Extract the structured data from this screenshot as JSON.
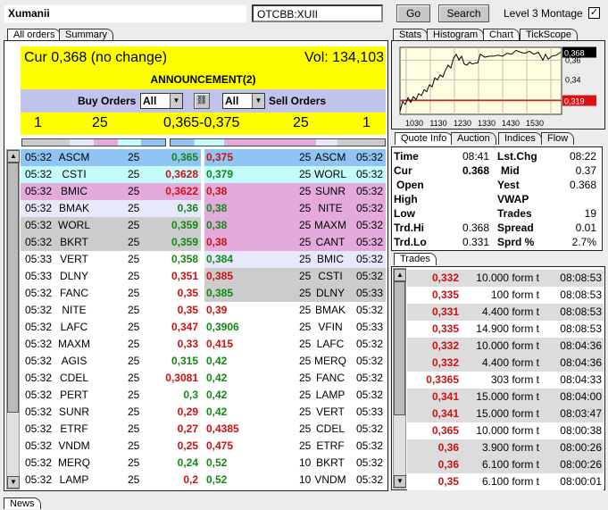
{
  "top": {
    "name": "Xumanii",
    "symbol": "OTCBB:XUII",
    "go": "Go",
    "search": "Search",
    "montage_label": "Level 3 Montage",
    "montage_checked": true
  },
  "left_tabs": [
    "All orders",
    "Summary"
  ],
  "header": {
    "cur": "Cur 0,368 (no change)",
    "vol": "Vol: 134,103",
    "announcement": "ANNOUNCEMENT(2)",
    "buy_label": "Buy Orders",
    "sell_label": "Sell Orders",
    "buy_filter": "All",
    "sell_filter": "All"
  },
  "depth": {
    "buy_count": "1",
    "buy_size": "25",
    "spread": "0,365-0,375",
    "sell_size": "25",
    "sell_count": "1"
  },
  "colors": {
    "blue": "#90c4f4",
    "cyan": "#c4fcfc",
    "pink": "#e4aadc",
    "lav": "#e8e8fc",
    "gray": "#cccccc",
    "white": "#ffffff"
  },
  "buy_orders": [
    {
      "time": "05:32",
      "firm": "ASCM",
      "size": "25",
      "price": "0,365",
      "dir": "g",
      "bg": "blue"
    },
    {
      "time": "05:32",
      "firm": "CSTI",
      "size": "25",
      "price": "0,3628",
      "dir": "r",
      "bg": "cyan"
    },
    {
      "time": "05:32",
      "firm": "BMIC",
      "size": "25",
      "price": "0,3622",
      "dir": "r",
      "bg": "pink"
    },
    {
      "time": "05:32",
      "firm": "BMAK",
      "size": "25",
      "price": "0,36",
      "dir": "g",
      "bg": "lav"
    },
    {
      "time": "05:32",
      "firm": "WORL",
      "size": "25",
      "price": "0,359",
      "dir": "g",
      "bg": "gray"
    },
    {
      "time": "05:32",
      "firm": "BKRT",
      "size": "25",
      "price": "0,359",
      "dir": "g",
      "bg": "gray"
    },
    {
      "time": "05:33",
      "firm": "VERT",
      "size": "25",
      "price": "0,358",
      "dir": "g",
      "bg": "white"
    },
    {
      "time": "05:33",
      "firm": "DLNY",
      "size": "25",
      "price": "0,351",
      "dir": "r",
      "bg": "white"
    },
    {
      "time": "05:32",
      "firm": "FANC",
      "size": "25",
      "price": "0,35",
      "dir": "r",
      "bg": "white"
    },
    {
      "time": "05:32",
      "firm": "NITE",
      "size": "25",
      "price": "0,35",
      "dir": "r",
      "bg": "white"
    },
    {
      "time": "05:32",
      "firm": "LAFC",
      "size": "25",
      "price": "0,347",
      "dir": "r",
      "bg": "white"
    },
    {
      "time": "05:32",
      "firm": "MAXM",
      "size": "25",
      "price": "0,33",
      "dir": "r",
      "bg": "white"
    },
    {
      "time": "05:32",
      "firm": "AGIS",
      "size": "25",
      "price": "0,315",
      "dir": "g",
      "bg": "white"
    },
    {
      "time": "05:32",
      "firm": "CDEL",
      "size": "25",
      "price": "0,3081",
      "dir": "r",
      "bg": "white"
    },
    {
      "time": "05:32",
      "firm": "PERT",
      "size": "25",
      "price": "0,3",
      "dir": "g",
      "bg": "white"
    },
    {
      "time": "05:32",
      "firm": "SUNR",
      "size": "25",
      "price": "0,29",
      "dir": "r",
      "bg": "white"
    },
    {
      "time": "05:32",
      "firm": "ETRF",
      "size": "25",
      "price": "0,27",
      "dir": "r",
      "bg": "white"
    },
    {
      "time": "05:32",
      "firm": "VNDM",
      "size": "25",
      "price": "0,25",
      "dir": "r",
      "bg": "white"
    },
    {
      "time": "05:32",
      "firm": "MERQ",
      "size": "25",
      "price": "0,24",
      "dir": "g",
      "bg": "white"
    },
    {
      "time": "05:32",
      "firm": "LAMP",
      "size": "25",
      "price": "0,2",
      "dir": "r",
      "bg": "white"
    }
  ],
  "sell_orders": [
    {
      "price": "0,375",
      "dir": "r",
      "size": "25",
      "firm": "ASCM",
      "time": "05:32",
      "bg": "blue"
    },
    {
      "price": "0,379",
      "dir": "g",
      "size": "25",
      "firm": "WORL",
      "time": "05:32",
      "bg": "cyan"
    },
    {
      "price": "0,38",
      "dir": "r",
      "size": "25",
      "firm": "SUNR",
      "time": "05:32",
      "bg": "pink"
    },
    {
      "price": "0,38",
      "dir": "g",
      "size": "25",
      "firm": "NITE",
      "time": "05:32",
      "bg": "pink"
    },
    {
      "price": "0,38",
      "dir": "g",
      "size": "25",
      "firm": "MAXM",
      "time": "05:32",
      "bg": "pink"
    },
    {
      "price": "0,38",
      "dir": "r",
      "size": "25",
      "firm": "CANT",
      "time": "05:32",
      "bg": "pink"
    },
    {
      "price": "0,384",
      "dir": "g",
      "size": "25",
      "firm": "BMIC",
      "time": "05:32",
      "bg": "lav"
    },
    {
      "price": "0,385",
      "dir": "r",
      "size": "25",
      "firm": "CSTI",
      "time": "05:32",
      "bg": "gray"
    },
    {
      "price": "0,385",
      "dir": "g",
      "size": "25",
      "firm": "DLNY",
      "time": "05:33",
      "bg": "gray"
    },
    {
      "price": "0,39",
      "dir": "r",
      "size": "25",
      "firm": "BMAK",
      "time": "05:32",
      "bg": "white"
    },
    {
      "price": "0,3906",
      "dir": "g",
      "size": "25",
      "firm": "VFIN",
      "time": "05:33",
      "bg": "white"
    },
    {
      "price": "0,415",
      "dir": "r",
      "size": "25",
      "firm": "LAFC",
      "time": "05:32",
      "bg": "white"
    },
    {
      "price": "0,42",
      "dir": "g",
      "size": "25",
      "firm": "MERQ",
      "time": "05:32",
      "bg": "white"
    },
    {
      "price": "0,42",
      "dir": "g",
      "size": "25",
      "firm": "FANC",
      "time": "05:32",
      "bg": "white"
    },
    {
      "price": "0,42",
      "dir": "g",
      "size": "25",
      "firm": "LAMP",
      "time": "05:32",
      "bg": "white"
    },
    {
      "price": "0,42",
      "dir": "g",
      "size": "25",
      "firm": "VERT",
      "time": "05:33",
      "bg": "white"
    },
    {
      "price": "0,4385",
      "dir": "r",
      "size": "25",
      "firm": "CDEL",
      "time": "05:32",
      "bg": "white"
    },
    {
      "price": "0,475",
      "dir": "r",
      "size": "25",
      "firm": "ETRF",
      "time": "05:32",
      "bg": "white"
    },
    {
      "price": "0,52",
      "dir": "g",
      "size": "10",
      "firm": "BKRT",
      "time": "05:32",
      "bg": "white"
    },
    {
      "price": "0,52",
      "dir": "g",
      "size": "10",
      "firm": "VNDM",
      "time": "05:32",
      "bg": "white"
    }
  ],
  "right_tabs": [
    "Stats",
    "Histogram",
    "Chart",
    "TickScope"
  ],
  "chart_data": {
    "type": "line",
    "x_ticks": [
      "1030",
      "1130",
      "1230",
      "1330",
      "1430",
      "1530"
    ],
    "y_ticks": [
      "0,36",
      "0,34"
    ],
    "ylim": [
      0.305,
      0.373
    ],
    "last_label": "0,368",
    "ref_label": "0,319",
    "ref_value": 0.319,
    "x": [
      0,
      3,
      6,
      9,
      12,
      15,
      18,
      21,
      24,
      27,
      30,
      33,
      36,
      39,
      42,
      45,
      48,
      51,
      54,
      57,
      60,
      63,
      66,
      69,
      72,
      75,
      78,
      81,
      84,
      87,
      90,
      95,
      100,
      105,
      110,
      115,
      120,
      125,
      130,
      135,
      140,
      145,
      150,
      155,
      160,
      163,
      166,
      170,
      175,
      180
    ],
    "y": [
      0.308,
      0.318,
      0.315,
      0.322,
      0.317,
      0.323,
      0.32,
      0.326,
      0.324,
      0.33,
      0.328,
      0.335,
      0.333,
      0.342,
      0.34,
      0.345,
      0.343,
      0.35,
      0.355,
      0.352,
      0.362,
      0.366,
      0.36,
      0.364,
      0.356,
      0.355,
      0.358,
      0.356,
      0.357,
      0.357,
      0.366,
      0.363,
      0.364,
      0.364,
      0.365,
      0.364,
      0.367,
      0.366,
      0.37,
      0.368,
      0.367,
      0.369,
      0.366,
      0.368,
      0.36,
      0.366,
      0.361,
      0.364,
      0.365,
      0.368
    ]
  },
  "quote_tabs": [
    "Quote Info",
    "Auction",
    "Indices",
    "Flow"
  ],
  "quote": [
    {
      "l": "Time",
      "v": "08:41",
      "l2": "Lst.Chg",
      "v2": "08:22"
    },
    {
      "l": "Cur",
      "v": "0.368",
      "l2": "Mid",
      "v2": "0.37"
    },
    {
      "l": "Open",
      "v": "",
      "l2": "Yest",
      "v2": "0.368"
    },
    {
      "l": "High",
      "v": "",
      "l2": "VWAP",
      "v2": ""
    },
    {
      "l": "Low",
      "v": "",
      "l2": "Trades",
      "v2": "19"
    },
    {
      "l": "Trd.Hi",
      "v": "0.368",
      "l2": "Spread",
      "v2": "0.01"
    },
    {
      "l": "Trd.Lo",
      "v": "0.331",
      "l2": "Sprd %",
      "v2": "2.7%"
    }
  ],
  "trades_tab": "Trades",
  "trades": [
    {
      "price": "0,332",
      "qty": "10.000 form t",
      "time": "08:08:53",
      "bg": "gray"
    },
    {
      "price": "0,335",
      "qty": "100 form t",
      "time": "08:08:53",
      "bg": "white"
    },
    {
      "price": "0,331",
      "qty": "4.400 form t",
      "time": "08:08:53",
      "bg": "gray"
    },
    {
      "price": "0,335",
      "qty": "14.900 form t",
      "time": "08:08:53",
      "bg": "white"
    },
    {
      "price": "0,332",
      "qty": "10.000 form t",
      "time": "08:04:36",
      "bg": "gray"
    },
    {
      "price": "0,332",
      "qty": "4.400 form t",
      "time": "08:04:36",
      "bg": "gray"
    },
    {
      "price": "0,3365",
      "qty": "303 form t",
      "time": "08:04:33",
      "bg": "white"
    },
    {
      "price": "0,341",
      "qty": "15.000 form t",
      "time": "08:04:00",
      "bg": "gray"
    },
    {
      "price": "0,341",
      "qty": "15.000 form t",
      "time": "08:03:47",
      "bg": "gray"
    },
    {
      "price": "0,365",
      "qty": "10.000 form t",
      "time": "08:00:38",
      "bg": "white"
    },
    {
      "price": "0,36",
      "qty": "3.900 form t",
      "time": "08:00:26",
      "bg": "gray"
    },
    {
      "price": "0,36",
      "qty": "6.100 form t",
      "time": "08:00:26",
      "bg": "gray"
    },
    {
      "price": "0,35",
      "qty": "6.100 form t",
      "time": "08:00:01",
      "bg": "white"
    }
  ],
  "bottom_tab": "News"
}
